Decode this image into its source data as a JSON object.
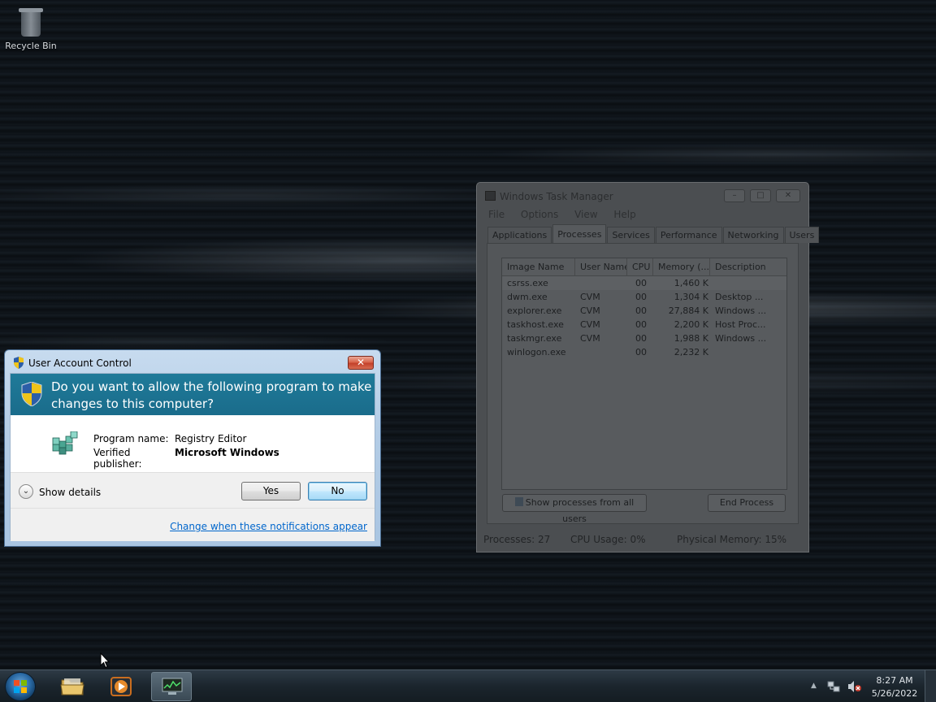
{
  "desktop": {
    "recycle_bin_label": "Recycle Bin"
  },
  "task_manager": {
    "title": "Windows Task Manager",
    "menu": [
      "File",
      "Options",
      "View",
      "Help"
    ],
    "tabs": [
      "Applications",
      "Processes",
      "Services",
      "Performance",
      "Networking",
      "Users"
    ],
    "active_tab": "Processes",
    "columns": [
      "Image Name",
      "User Name",
      "CPU",
      "Memory (...",
      "Description"
    ],
    "rows": [
      {
        "image": "csrss.exe",
        "user": "",
        "cpu": "00",
        "memory": "1,460 K",
        "desc": ""
      },
      {
        "image": "dwm.exe",
        "user": "CVM",
        "cpu": "00",
        "memory": "1,304 K",
        "desc": "Desktop ..."
      },
      {
        "image": "explorer.exe",
        "user": "CVM",
        "cpu": "00",
        "memory": "27,884 K",
        "desc": "Windows ..."
      },
      {
        "image": "taskhost.exe",
        "user": "CVM",
        "cpu": "00",
        "memory": "2,200 K",
        "desc": "Host Proc..."
      },
      {
        "image": "taskmgr.exe",
        "user": "CVM",
        "cpu": "00",
        "memory": "1,988 K",
        "desc": "Windows ..."
      },
      {
        "image": "winlogon.exe",
        "user": "",
        "cpu": "00",
        "memory": "2,232 K",
        "desc": ""
      }
    ],
    "show_all_button": "Show processes from all users",
    "end_process_button": "End Process",
    "status": {
      "processes": "Processes: 27",
      "cpu": "CPU Usage: 0%",
      "memory": "Physical Memory: 15%"
    }
  },
  "uac": {
    "title": "User Account Control",
    "question": "Do you want to allow the following program to make changes to this computer?",
    "program_name_label": "Program name:",
    "program_name_value": "Registry Editor",
    "publisher_label": "Verified publisher:",
    "publisher_value": "Microsoft Windows",
    "show_details": "Show details",
    "yes_button": "Yes",
    "no_button": "No",
    "change_link": "Change when these notifications appear",
    "colors": {
      "banner": "#1a6c8b",
      "link": "#0066cc"
    }
  },
  "taskbar": {
    "items": [
      "start-orb",
      "explorer-folder-icon",
      "media-player-icon",
      "task-manager-icon"
    ],
    "clock_time": "8:27 AM",
    "clock_date": "5/26/2022"
  }
}
